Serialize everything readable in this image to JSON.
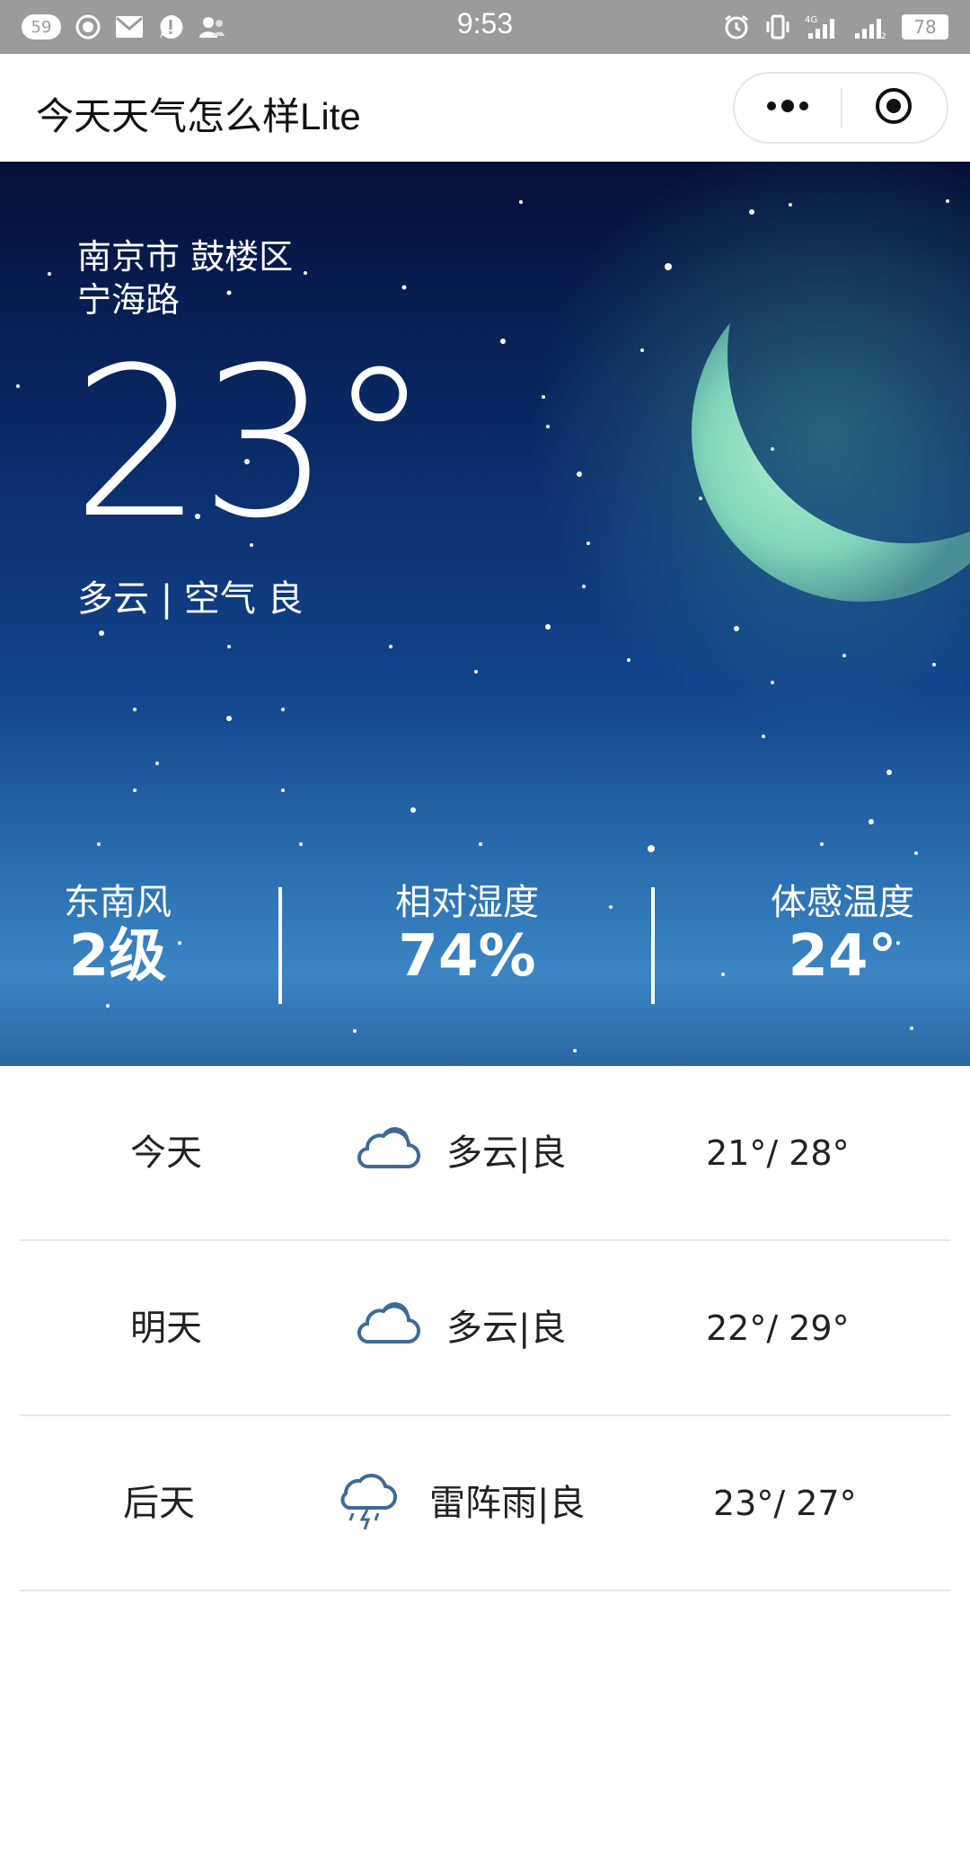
{
  "status_bar": {
    "badge": "59",
    "time": "9:53",
    "network": "4G",
    "battery": "78"
  },
  "titlebar": {
    "title": "今天天气怎么样Lite",
    "icons": [
      "more-icon",
      "target-icon"
    ]
  },
  "current": {
    "location_line1": "南京市 鼓楼区",
    "location_line2": "宁海路",
    "temperature": "23°",
    "condition": "多云 | 空气 良"
  },
  "stats": [
    {
      "label": "东南风",
      "value": "2级"
    },
    {
      "label": "相对湿度",
      "value": "74%"
    },
    {
      "label": "体感温度",
      "value": "24°"
    }
  ],
  "forecast": [
    {
      "day": "今天",
      "icon": "cloud-icon",
      "desc": "多云|良",
      "temp": "21°/ 28°"
    },
    {
      "day": "明天",
      "icon": "cloud-icon",
      "desc": "多云|良",
      "temp": "22°/ 29°"
    },
    {
      "day": "后天",
      "icon": "thunderstorm-icon",
      "desc": "雷阵雨|良",
      "temp": "23°/ 27°"
    }
  ]
}
